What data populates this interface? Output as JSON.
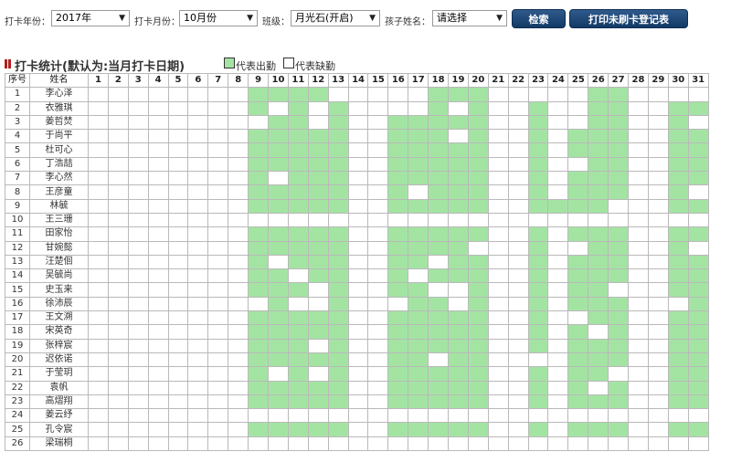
{
  "toolbar": {
    "year_label": "打卡年份：",
    "year_value": "2017年",
    "month_label": "打卡月份：",
    "month_value": "10月份",
    "class_label": "班级：",
    "class_value": "月光石(开启)",
    "child_label": "孩子姓名：",
    "child_value": "请选择",
    "search_button": "检索",
    "print_button": "打印未刷卡登记表"
  },
  "section": {
    "title": "打卡统计(默认为:当月打卡日期)",
    "legend_present": "代表出勤",
    "legend_absent": "代表缺勤"
  },
  "colors": {
    "present": "#a3e4a3",
    "absent": "#ffffff",
    "button": "#1d4676"
  },
  "table": {
    "col_index": "序号",
    "col_name": "姓名",
    "days": [
      "1",
      "2",
      "3",
      "4",
      "5",
      "6",
      "7",
      "8",
      "9",
      "10",
      "11",
      "12",
      "13",
      "14",
      "15",
      "16",
      "17",
      "18",
      "19",
      "20",
      "21",
      "22",
      "23",
      "24",
      "25",
      "26",
      "27",
      "28",
      "29",
      "30",
      "31"
    ],
    "rows": [
      {
        "no": "1",
        "name": "李心泽",
        "present": [
          9,
          10,
          11,
          12,
          18,
          19,
          20,
          26,
          27
        ]
      },
      {
        "no": "2",
        "name": "衣雅琪",
        "present": [
          9,
          11,
          13,
          18,
          20,
          23,
          26,
          27,
          30,
          31
        ]
      },
      {
        "no": "3",
        "name": "姜哲焚",
        "present": [
          10,
          11,
          13,
          16,
          17,
          18,
          19,
          20,
          23,
          26,
          27,
          30
        ]
      },
      {
        "no": "4",
        "name": "于尚平",
        "present": [
          9,
          10,
          11,
          12,
          13,
          16,
          17,
          18,
          20,
          23,
          25,
          26,
          27,
          30,
          31
        ]
      },
      {
        "no": "5",
        "name": "杜可心",
        "present": [
          9,
          10,
          11,
          12,
          13,
          16,
          17,
          18,
          19,
          20,
          23,
          25,
          26,
          27,
          30,
          31
        ]
      },
      {
        "no": "6",
        "name": "丁浩喆",
        "present": [
          9,
          10,
          11,
          12,
          13,
          16,
          17,
          18,
          19,
          20,
          23,
          26,
          27,
          30,
          31
        ]
      },
      {
        "no": "7",
        "name": "李心然",
        "present": [
          9,
          11,
          12,
          13,
          16,
          17,
          18,
          19,
          20,
          23,
          25,
          26,
          27,
          30,
          31
        ]
      },
      {
        "no": "8",
        "name": "王彦童",
        "present": [
          9,
          10,
          11,
          12,
          13,
          16,
          18,
          19,
          20,
          23,
          25,
          26,
          27,
          30
        ]
      },
      {
        "no": "9",
        "name": "林毓",
        "present": [
          9,
          10,
          11,
          12,
          13,
          16,
          17,
          18,
          19,
          20,
          23,
          24,
          25,
          26,
          30,
          31
        ]
      },
      {
        "no": "10",
        "name": "王三珊",
        "present": []
      },
      {
        "no": "11",
        "name": "田家怡",
        "present": [
          9,
          10,
          11,
          12,
          13,
          16,
          17,
          18,
          19,
          20,
          23,
          25,
          26,
          27,
          30,
          31
        ]
      },
      {
        "no": "12",
        "name": "甘婉懿",
        "present": [
          9,
          10,
          11,
          12,
          13,
          16,
          17,
          18,
          19,
          23,
          26,
          27,
          30
        ]
      },
      {
        "no": "13",
        "name": "汪楚佪",
        "present": [
          9,
          11,
          12,
          13,
          16,
          17,
          19,
          20,
          23,
          25,
          26,
          27,
          30,
          31
        ]
      },
      {
        "no": "14",
        "name": "吴毓尚",
        "present": [
          9,
          10,
          12,
          13,
          16,
          18,
          19,
          20,
          23,
          25,
          26,
          27,
          30,
          31
        ]
      },
      {
        "no": "15",
        "name": "史玉来",
        "present": [
          9,
          10,
          11,
          13,
          16,
          17,
          20,
          23,
          25,
          26,
          30,
          31
        ]
      },
      {
        "no": "16",
        "name": "徐沛辰",
        "present": [
          10,
          13,
          17,
          18,
          20,
          23,
          25,
          26,
          27,
          31
        ]
      },
      {
        "no": "17",
        "name": "王文溯",
        "present": [
          9,
          10,
          11,
          12,
          13,
          16,
          17,
          18,
          19,
          20,
          23,
          26,
          27,
          30,
          31
        ]
      },
      {
        "no": "18",
        "name": "宋英奇",
        "present": [
          9,
          10,
          11,
          12,
          13,
          16,
          17,
          18,
          19,
          20,
          23,
          25,
          27,
          30,
          31
        ]
      },
      {
        "no": "19",
        "name": "张梓宸",
        "present": [
          9,
          10,
          11,
          13,
          16,
          17,
          18,
          19,
          20,
          23,
          25,
          26,
          27,
          30,
          31
        ]
      },
      {
        "no": "20",
        "name": "迟依诺",
        "present": [
          9,
          10,
          11,
          12,
          13,
          16,
          17,
          19,
          20,
          25,
          26,
          27,
          30,
          31
        ]
      },
      {
        "no": "21",
        "name": "于莹玥",
        "present": [
          9,
          11,
          13,
          16,
          17,
          18,
          19,
          20,
          23,
          25,
          26,
          30,
          31
        ]
      },
      {
        "no": "22",
        "name": "袁帆",
        "present": [
          9,
          10,
          11,
          12,
          13,
          16,
          17,
          18,
          19,
          20,
          23,
          25,
          27,
          30,
          31
        ]
      },
      {
        "no": "23",
        "name": "高熠翔",
        "present": [
          9,
          10,
          11,
          12,
          13,
          16,
          17,
          18,
          19,
          20,
          23,
          25,
          26,
          27,
          30,
          31
        ]
      },
      {
        "no": "24",
        "name": "姜云纾",
        "present": []
      },
      {
        "no": "25",
        "name": "孔令宸",
        "present": [
          9,
          10,
          11,
          12,
          13,
          16,
          17,
          18,
          19,
          20,
          23,
          25,
          26,
          27,
          30,
          31
        ]
      },
      {
        "no": "26",
        "name": "梁瑞桐",
        "present": []
      }
    ]
  }
}
